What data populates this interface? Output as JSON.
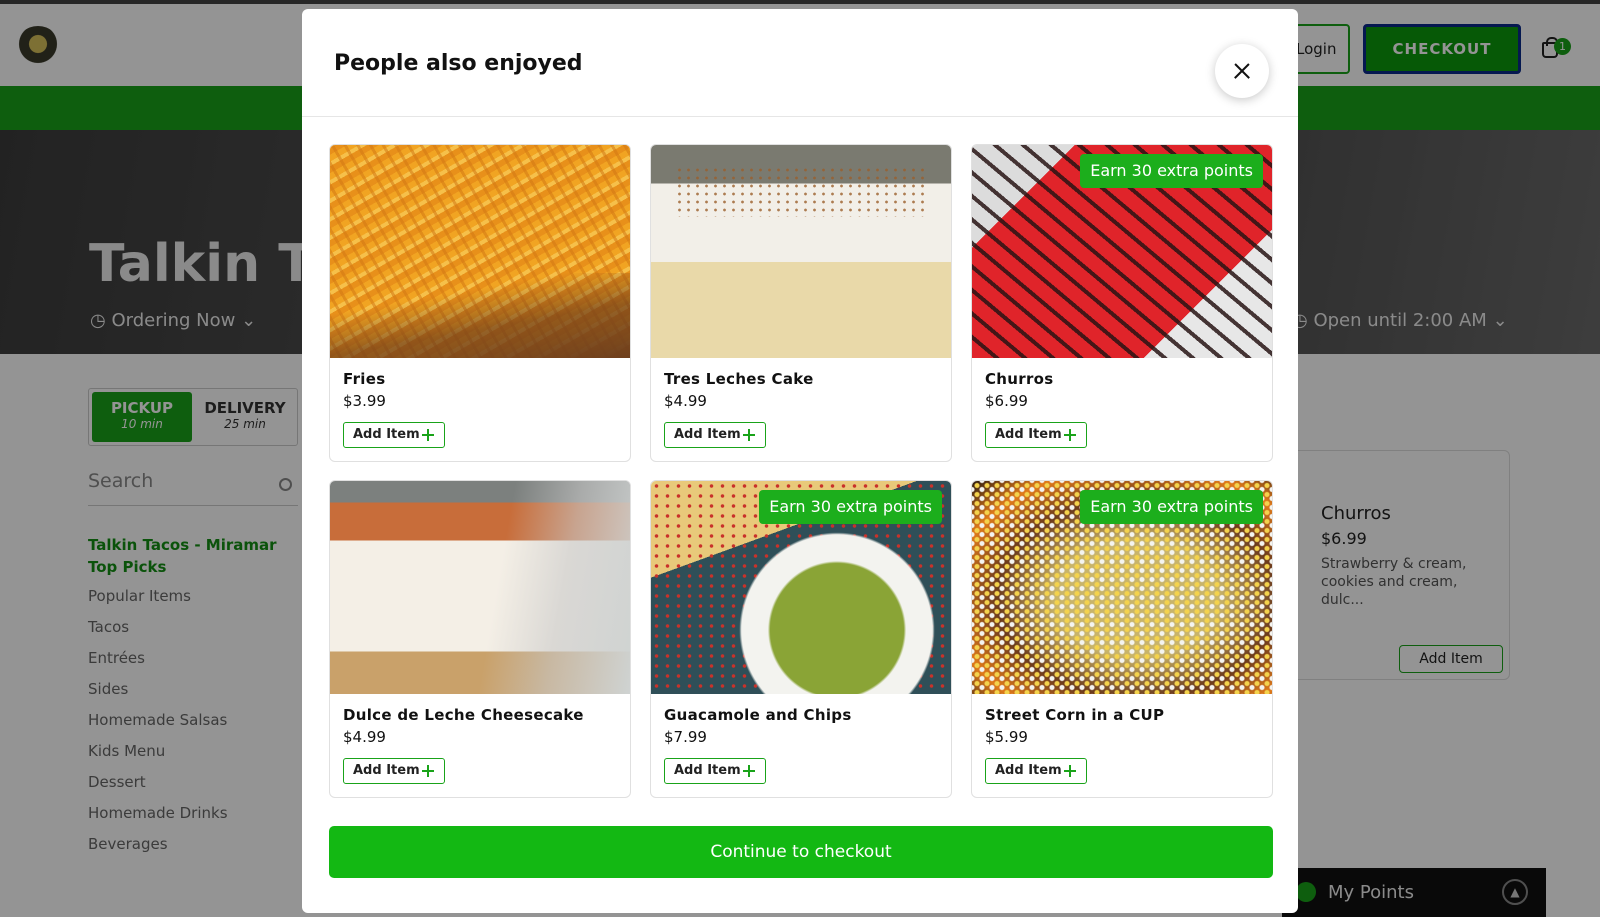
{
  "header": {
    "login_label": "Login",
    "checkout_label": "CHECKOUT",
    "cart_count": "1"
  },
  "hero": {
    "title": "Talkin Ta",
    "ordering": "Ordering Now",
    "open_until": "Open until 2:00 AM"
  },
  "order_mode": {
    "pickup_label": "PICKUP",
    "pickup_time": "10 min",
    "delivery_label": "DELIVERY",
    "delivery_time": "25 min"
  },
  "search": {
    "placeholder": "Search"
  },
  "categories": [
    "Talkin Tacos - Miramar Top Picks",
    "Popular Items",
    "Tacos",
    "Entrées",
    "Sides",
    "Homemade Salsas",
    "Kids Menu",
    "Dessert",
    "Homemade Drinks",
    "Beverages"
  ],
  "background_card": {
    "name": "Churros",
    "price": "$6.99",
    "description": "Strawberry & cream, cookies and cream, dulc...",
    "add_label": "Add Item"
  },
  "points_widget": {
    "label": "My Points"
  },
  "modal": {
    "title": "People also enjoyed",
    "continue_label": "Continue to checkout",
    "items": [
      {
        "name": "Fries",
        "price": "$3.99",
        "badge": "",
        "add_label": "Add Item"
      },
      {
        "name": "Tres Leches Cake",
        "price": "$4.99",
        "badge": "",
        "add_label": "Add Item"
      },
      {
        "name": "Churros",
        "price": "$6.99",
        "badge": "Earn 30 extra points",
        "add_label": "Add Item"
      },
      {
        "name": "Dulce de Leche Cheesecake",
        "price": "$4.99",
        "badge": "",
        "add_label": "Add Item"
      },
      {
        "name": "Guacamole and Chips",
        "price": "$7.99",
        "badge": "Earn 30 extra points",
        "add_label": "Add Item"
      },
      {
        "name": "Street Corn in a CUP",
        "price": "$5.99",
        "badge": "Earn 30 extra points",
        "add_label": "Add Item"
      }
    ]
  },
  "colors": {
    "brand_green": "#19a319",
    "badge_green": "#1cae1c",
    "continue_green": "#13b813"
  }
}
